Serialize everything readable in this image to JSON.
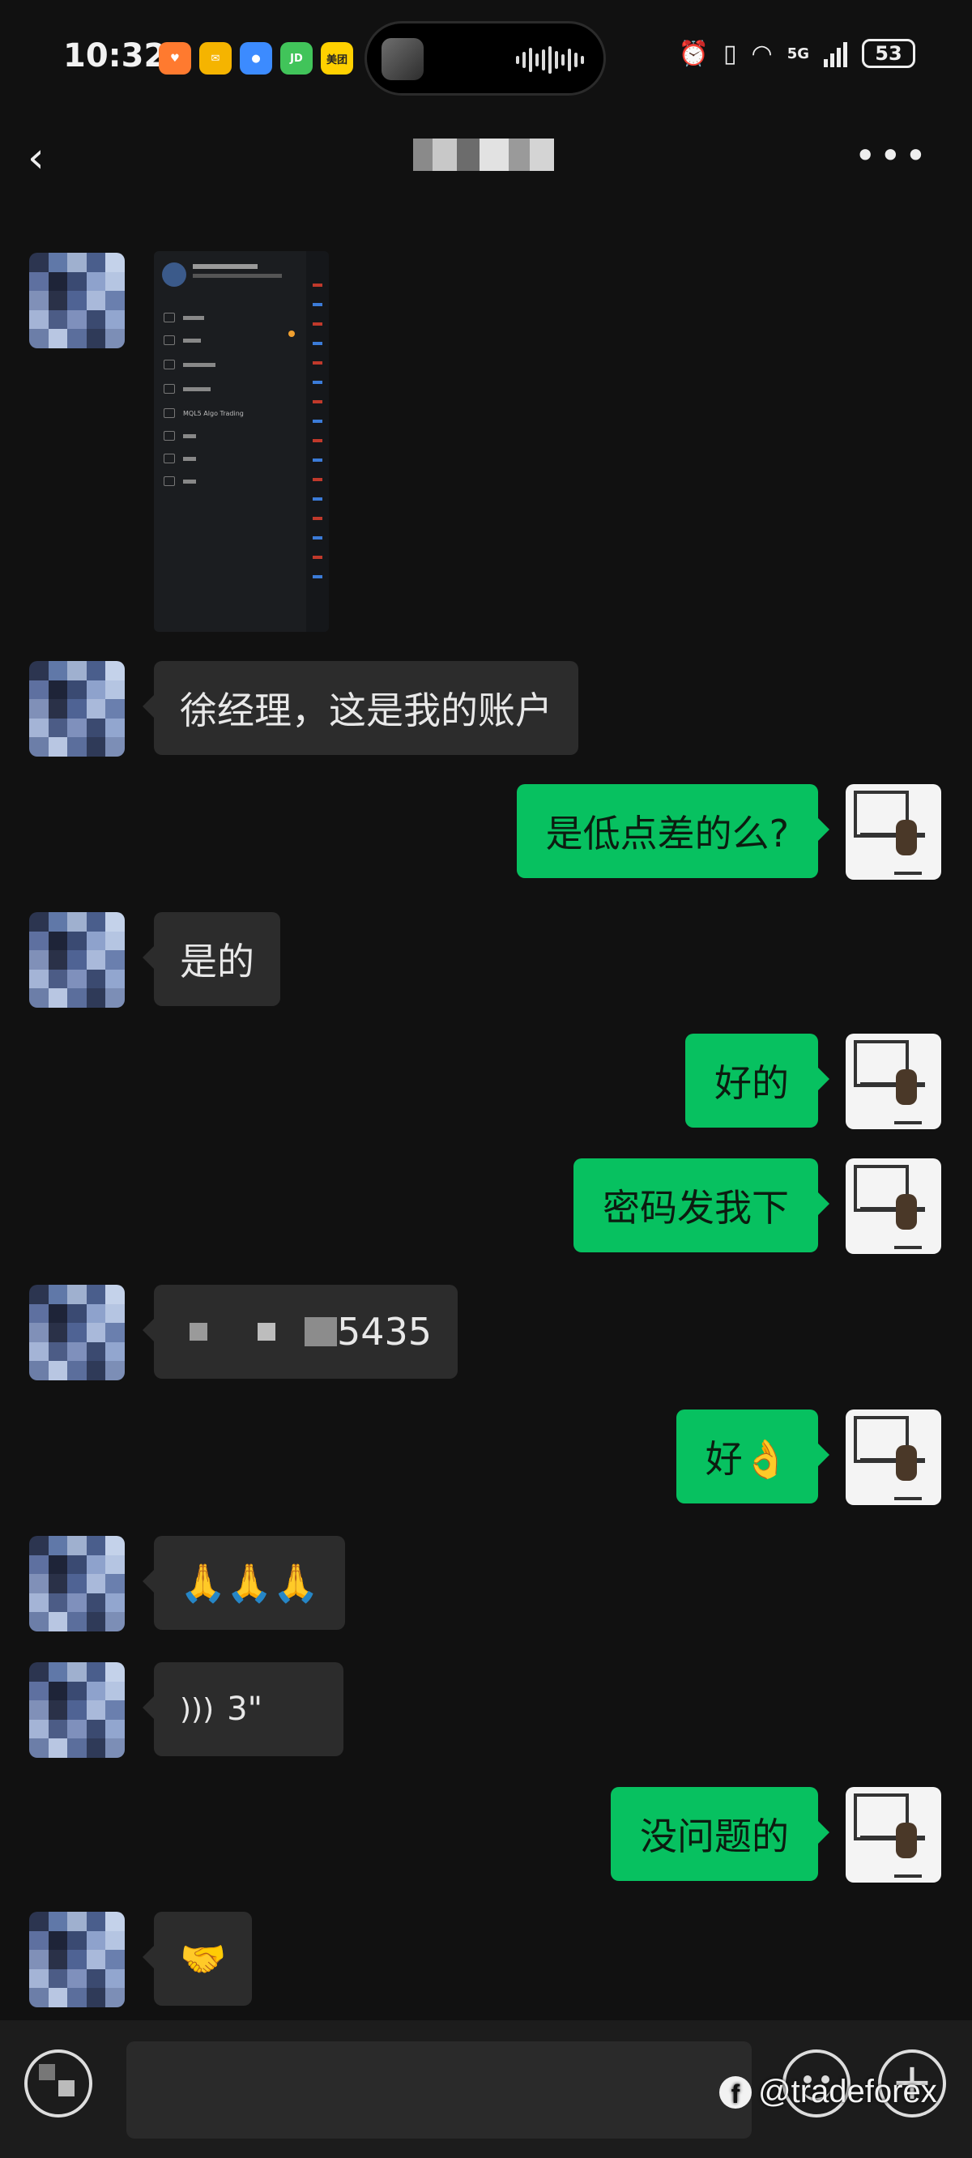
{
  "status_bar": {
    "time": "10:32",
    "app_icons": [
      "taobao-icon",
      "mail-icon",
      "message-icon",
      "jd-icon",
      "meituan-icon"
    ],
    "meituan_label": "美团",
    "network": "5G",
    "battery": "53"
  },
  "header": {
    "back_icon": "chevron-left-icon",
    "more_icon": "more-dots-icon"
  },
  "messages": [
    {
      "side": "in",
      "type": "image"
    },
    {
      "side": "in",
      "text": "徐经理，这是我的账户"
    },
    {
      "side": "out",
      "text": "是低点差的么?"
    },
    {
      "side": "in",
      "text": "是的"
    },
    {
      "side": "out",
      "text": "好的"
    },
    {
      "side": "out",
      "text": "密码发我下"
    },
    {
      "side": "in",
      "text": "5435"
    },
    {
      "side": "out",
      "text": "好👌"
    },
    {
      "side": "in",
      "text": "🙏🙏🙏"
    },
    {
      "side": "in",
      "type": "voice",
      "text": "3\""
    },
    {
      "side": "out",
      "text": "没问题的"
    },
    {
      "side": "in",
      "text": "🤝"
    }
  ],
  "shared_image": {
    "menu_items": [
      "",
      "",
      "",
      "",
      "MQL5 Algo Trading",
      "",
      "",
      ""
    ]
  },
  "input_bar": {
    "voice_icon": "voice-icon",
    "emoji_icon": "emoji-icon",
    "plus_icon": "plus-icon"
  },
  "watermark": "@tradeforex",
  "colors": {
    "background": "#111111",
    "incoming_bubble": "#2c2c2c",
    "outgoing_bubble": "#07c160"
  }
}
